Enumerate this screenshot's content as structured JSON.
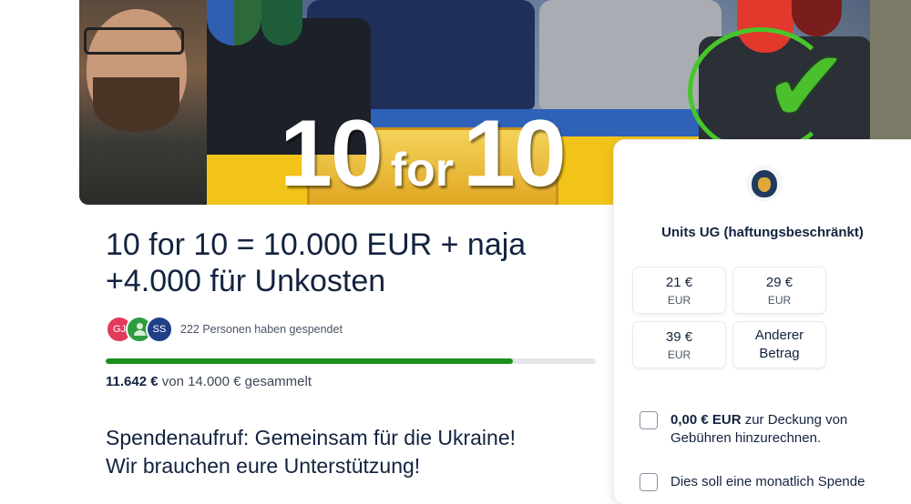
{
  "hero": {
    "headline_number_left": "10",
    "headline_connector": "for",
    "headline_number_right": "10"
  },
  "campaign": {
    "title": "10 for 10 = 10.000 EUR + naja +4.000 für Unkosten",
    "donor_avatars": [
      {
        "initials": "GJ",
        "color": "#e23a5a"
      },
      {
        "initials": "",
        "icon": "person-icon",
        "color": "#2e9b3e"
      },
      {
        "initials": "SS",
        "color": "#1f3f86"
      }
    ],
    "donor_count_text": "222 Personen haben gespendet",
    "progress": {
      "raised": 11642,
      "goal": 14000,
      "fraction": 0.8316,
      "color": "#1a8f1a"
    },
    "raised_amount": "11.642 €",
    "raised_suffix": "von 14.000 € gesammelt",
    "appeal_line1": "Spendenaufruf: Gemeinsam für die Ukraine!",
    "appeal_line2": "Wir brauchen eure Unterstützung!"
  },
  "donation_card": {
    "org_logo_icon": "lion-icon",
    "org_name": "Units UG (haftungsbeschränkt)",
    "amounts": [
      {
        "value": "21 €",
        "currency": "EUR"
      },
      {
        "value": "29 €",
        "currency": "EUR"
      },
      {
        "value": "39 €",
        "currency": "EUR"
      }
    ],
    "other_amount_line1": "Anderer",
    "other_amount_line2": "Betrag",
    "fee_checkbox": {
      "amount": "0,00 € EUR",
      "text": " zur Deckung von Gebühren hinzurechnen.",
      "checked": false
    },
    "monthly_checkbox": {
      "text": "Dies soll eine monatlich Spende",
      "checked": false
    }
  }
}
